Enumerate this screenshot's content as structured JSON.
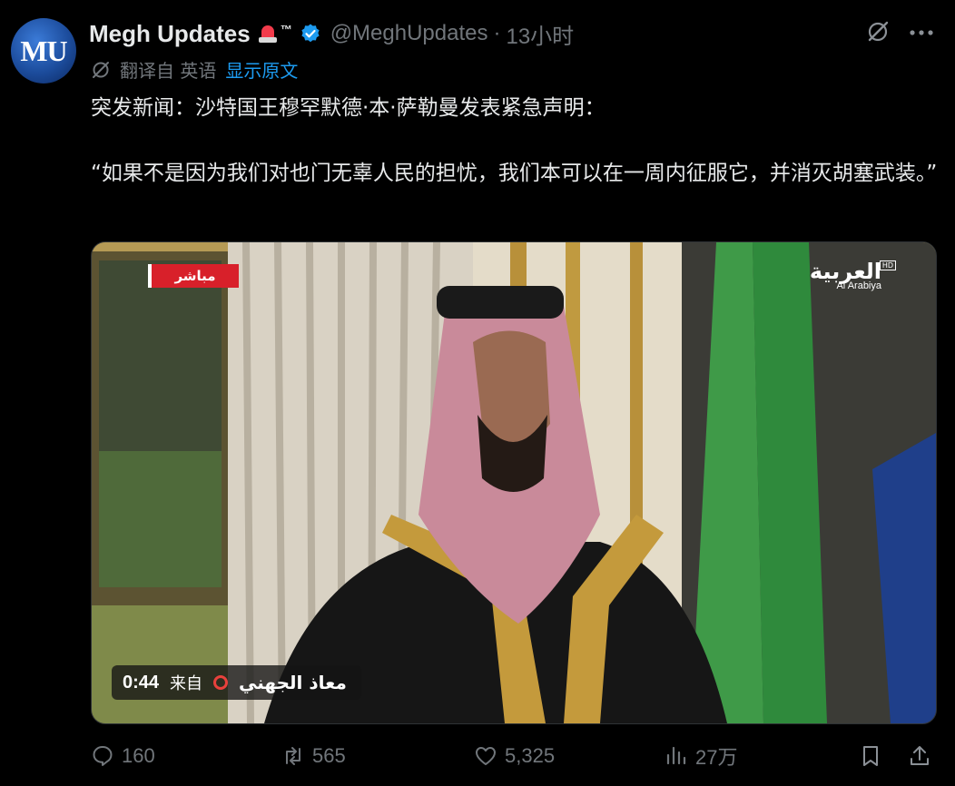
{
  "author": {
    "avatar_text": "MU",
    "name": "Megh Updates",
    "tm": "™",
    "handle": "@MeghUpdates",
    "separator": "·",
    "time": "13小时"
  },
  "translation": {
    "label": "翻译自 英语",
    "link": "显示原文"
  },
  "tweet": {
    "line1": "突发新闻：沙特国王穆罕默德·本·萨勒曼发表紧急声明：",
    "quote": "“如果不是因为我们对也门无辜人民的担忧，我们本可以在一周内征服它，并消灭胡塞武装。”"
  },
  "video": {
    "live_badge": "مباشر",
    "channel_logo_ar": "العربية",
    "channel_logo_en": "Al Arabiya",
    "channel_hd": "HD",
    "duration": "0:44",
    "from_label": "来自",
    "source_name": "معاذ الجهني"
  },
  "actions": {
    "replies": "160",
    "reposts": "565",
    "likes": "5,325",
    "views": "27万"
  },
  "icons": {
    "verified": "verified-badge-icon",
    "grok": "grok-icon",
    "more": "more-icon",
    "reply": "reply-icon",
    "repost": "repost-icon",
    "like": "heart-icon",
    "views": "views-icon",
    "bookmark": "bookmark-icon",
    "share": "share-icon"
  },
  "colors": {
    "background": "#000000",
    "text": "#e7e9ea",
    "secondary": "#71767b",
    "link": "#1d9bf0",
    "live_red": "#d8202a"
  }
}
